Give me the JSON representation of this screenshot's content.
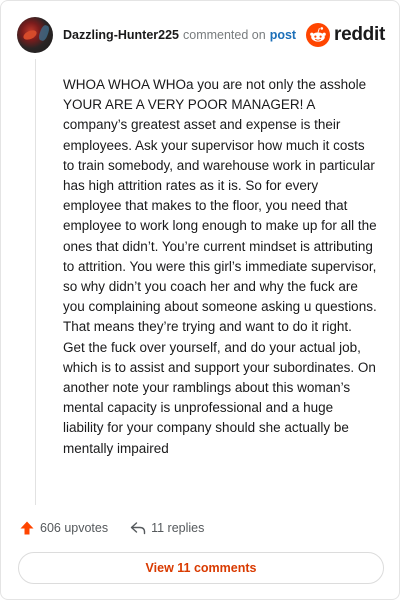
{
  "comment": {
    "author": "Dazzling-Hunter225",
    "action_text": "commented on",
    "post_link_label": "post",
    "body": "WHOA WHOA WHOa you are not only the asshole YOUR ARE A VERY POOR MANAGER! A company’s greatest asset and expense is their employees. Ask your supervisor how much it costs to train somebody, and warehouse work in particular has high attrition rates as it is. So for every employee that makes to the floor, you need that employee to work long enough to make up for all the ones that didn’t. You’re current mindset is attributing to attrition. You were this girl’s immediate supervisor, so why didn’t you coach her and why the fuck are you complaining about someone asking u questions. That means they’re trying and want to do it right. Get the fuck over yourself, and do your actual job, which is to assist and support your subordinates. On another note your ramblings about this woman’s mental capacity is unprofessional and a huge liability for your company should she actually be mentally impaired",
    "upvotes_label": "606 upvotes",
    "replies_label": "11 replies",
    "view_comments_label": "View 11 comments"
  },
  "brand": {
    "wordmark": "reddit",
    "logo_icon": "reddit-snoo-icon"
  },
  "icons": {
    "upvote": "upvote-arrow-icon",
    "reply": "reply-arrow-icon",
    "avatar": "user-avatar"
  },
  "colors": {
    "brand_orange": "#ff4500",
    "link_blue": "#1c6fb8",
    "action_orange": "#d93a00",
    "upvote_orange": "#ff4500",
    "muted_text": "#787c7e"
  }
}
